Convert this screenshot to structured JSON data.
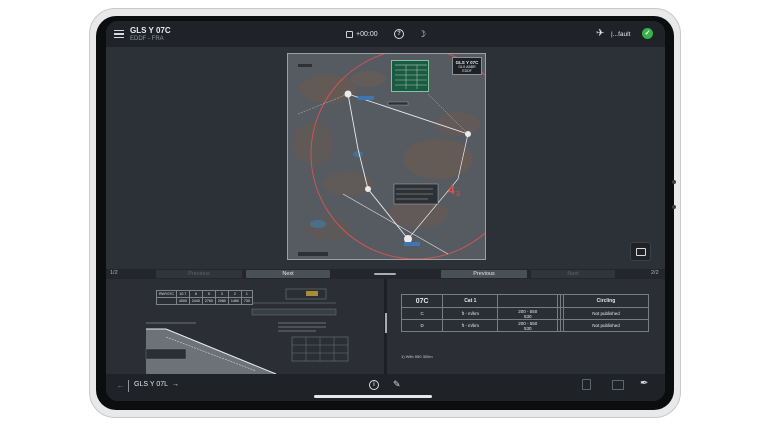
{
  "header": {
    "title": "GLS Y 07C",
    "subtitle": "EDDF - FRA",
    "time_offset": "+00:00",
    "profile": "|...fault"
  },
  "chart": {
    "box_title": "GLS Y 07C",
    "box_sub1": "GLS ABBR",
    "box_sub2": "EDDF",
    "label_4s": "4₃"
  },
  "pager": {
    "left_page": "1/2",
    "left_prev": "Previous",
    "left_next": "Next",
    "right_prev": "Previous",
    "right_next": "Next",
    "right_page": "2/2"
  },
  "profile_panel": {
    "mins_rows": [
      [
        "RWY07C",
        "10.7",
        "6",
        "5",
        "3",
        "2",
        "1"
      ],
      [
        "",
        "4000",
        "2440",
        "2760",
        "2080",
        "1460",
        "730"
      ]
    ]
  },
  "minima_panel": {
    "headers": [
      "07C",
      "Cat 1",
      "",
      "",
      "",
      "Circling"
    ],
    "rows": [
      {
        "cat": "C",
        "unit": "ft - m/km",
        "vals": "200 - 550\n530",
        "circ": "Not published"
      },
      {
        "cat": "D",
        "unit": "ft - m/km",
        "vals": "200 - 550\n530",
        "circ": "Not published"
      }
    ],
    "note": "1) With 550 300m"
  },
  "bottombar": {
    "next_chart": "GLS Y 07L"
  },
  "colors": {
    "ok": "#35b34a",
    "accent_green": "#1b5a42",
    "approach_red": "#d9534f"
  }
}
